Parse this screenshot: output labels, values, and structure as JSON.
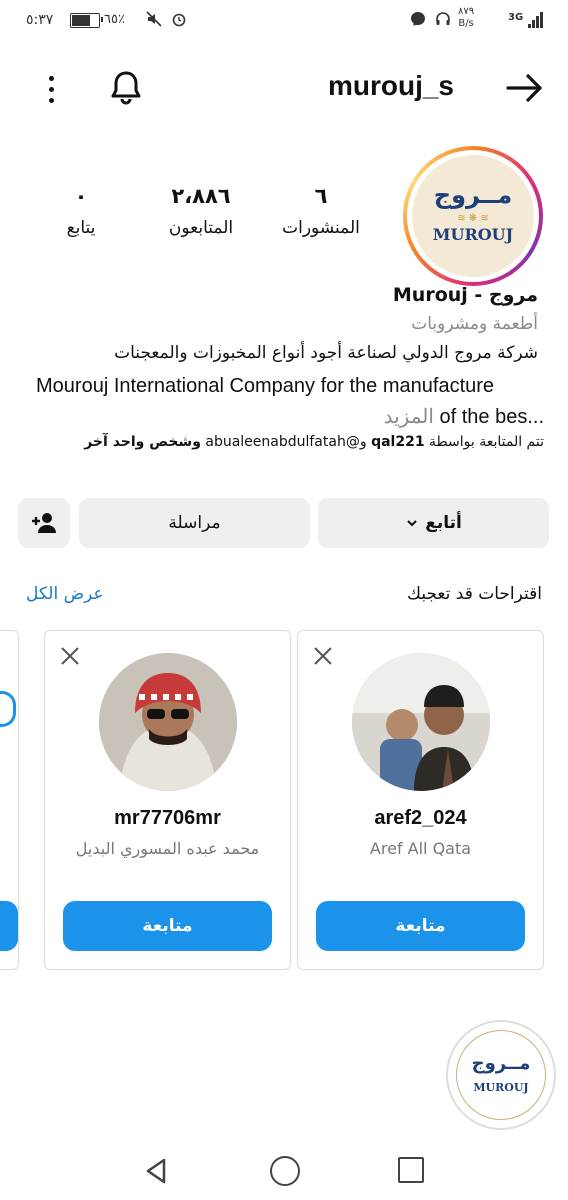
{
  "status_bar": {
    "time": "٥:٣٧",
    "battery_percent_text": "٦٥٪",
    "battery_level": 0.65,
    "speed_value": "٨٧٩",
    "speed_unit": "B/s",
    "network": "3G"
  },
  "header": {
    "username": "murouj_s",
    "menu_icon": "more-vertical-icon",
    "bell_icon": "bell-icon",
    "back_icon": "arrow-right-icon"
  },
  "avatar": {
    "logo_arabic": "مــروج",
    "logo_english": "MUROUJ"
  },
  "stats": [
    {
      "value": "٦",
      "label": "المنشورات"
    },
    {
      "value": "٢،٨٨٦",
      "label": "المتابعون"
    },
    {
      "value": "٠",
      "label": "يتابع"
    }
  ],
  "profile": {
    "name": "مروج - Murouj",
    "category": "أطعمة ومشروبات",
    "bio_arabic": "شركة مروج الدولي لصناعة أجود أنواع المخبوزات والمعجنات",
    "bio_english_1": "Mourouj International Company for the manufacture",
    "bio_english_2": "of the bes...",
    "more_label": "المزيد",
    "followed_by_prefix": "تتم المتابعة بواسطة",
    "followed_by_user1": "qal221",
    "followed_by_and": "و@",
    "followed_by_user2": "abualeenabdulfatah",
    "followed_by_suffix": "وشخص واحد آخر"
  },
  "actions": {
    "follow_label": "أتابع",
    "message_label": "مراسلة"
  },
  "suggestions": {
    "title": "اقتراحات قد تعجبك",
    "see_all": "عرض الكل",
    "cards": [
      {
        "username": "aref2_024",
        "full_name": "Aref All Qata",
        "follow_label": "متابعة"
      },
      {
        "username": "mr77706mr",
        "full_name": "محمد عبده المسوري البديل",
        "follow_label": "متابعة"
      }
    ]
  },
  "watermark": {
    "arabic": "مــروج",
    "english": "MUROUJ"
  },
  "colors": {
    "accent_blue": "#1c93ea",
    "link_blue": "#1b7cc4",
    "button_gray": "#efefef"
  }
}
